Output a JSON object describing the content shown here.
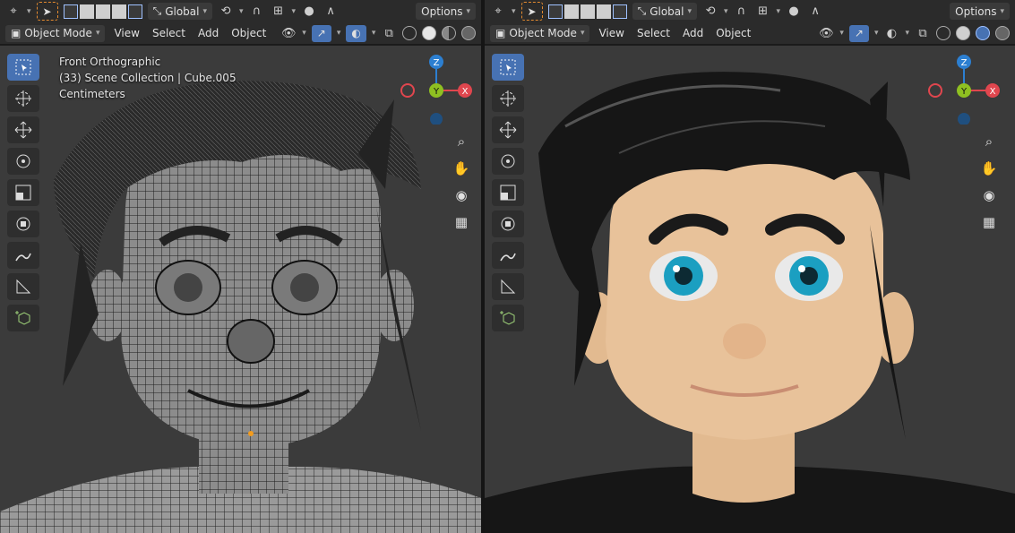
{
  "left": {
    "header1": {
      "orientation": "Global",
      "options": "Options"
    },
    "header2": {
      "mode": "Object Mode",
      "menus": [
        "View",
        "Select",
        "Add",
        "Object"
      ]
    },
    "overlay": {
      "view_name": "Front Orthographic",
      "collection": "(33) Scene Collection | Cube.005",
      "units": "Centimeters"
    },
    "gizmo": {
      "z": "Z",
      "y": "Y",
      "x": "X"
    }
  },
  "right": {
    "header1": {
      "orientation": "Global",
      "options": "Options"
    },
    "header2": {
      "mode": "Object Mode",
      "menus": [
        "View",
        "Select",
        "Add",
        "Object"
      ]
    },
    "gizmo": {
      "z": "Z",
      "y": "Y",
      "x": "X"
    }
  },
  "tools": [
    "select-box",
    "cursor",
    "move",
    "rotate",
    "scale",
    "transform",
    "annotate",
    "measure",
    "add-cube"
  ],
  "colors": {
    "accent": "#4772b3",
    "axis_x": "#e0464e",
    "axis_y": "#8fc021",
    "axis_z": "#2c7fd1",
    "skin": "#e8c29a",
    "hair": "#161616",
    "iris": "#1b9fc1"
  }
}
